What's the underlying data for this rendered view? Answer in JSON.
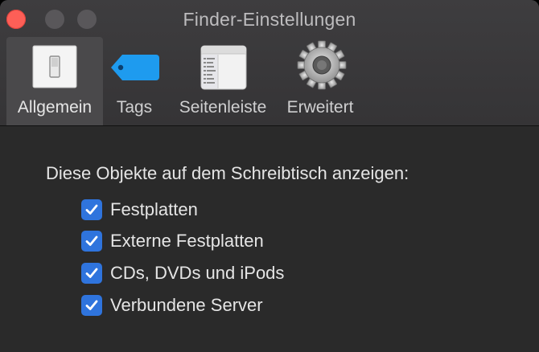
{
  "window": {
    "title": "Finder-Einstellungen"
  },
  "tabs": [
    {
      "label": "Allgemein",
      "icon": "general-switch-icon",
      "selected": true
    },
    {
      "label": "Tags",
      "icon": "tag-icon",
      "selected": false
    },
    {
      "label": "Seitenleiste",
      "icon": "sidebar-icon",
      "selected": false
    },
    {
      "label": "Erweitert",
      "icon": "gear-icon",
      "selected": false
    }
  ],
  "general": {
    "heading": "Diese Objekte auf dem Schreibtisch anzeigen:",
    "options": [
      {
        "label": "Festplatten",
        "checked": true
      },
      {
        "label": "Externe Festplatten",
        "checked": true
      },
      {
        "label": "CDs, DVDs und iPods",
        "checked": true
      },
      {
        "label": "Verbundene Server",
        "checked": true
      }
    ]
  },
  "colors": {
    "accent": "#2f74dd",
    "close": "#fd5f57",
    "tag": "#1e9bef"
  }
}
